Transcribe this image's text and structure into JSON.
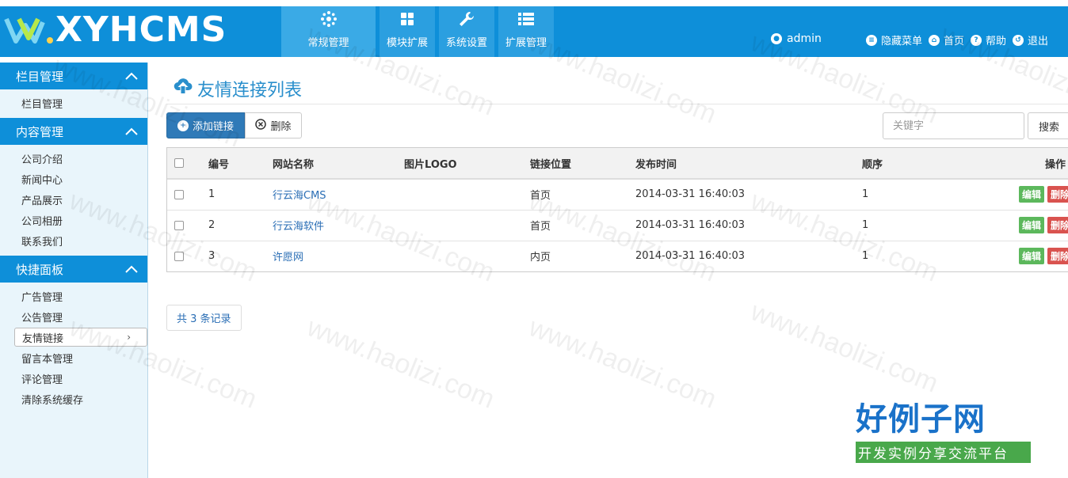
{
  "app": {
    "logo_text": "XYHCMS"
  },
  "topnav": [
    {
      "label": "常规管理",
      "icon": "gear-flower-icon",
      "active": true
    },
    {
      "label": "模块扩展",
      "icon": "grid-icon",
      "active": false
    },
    {
      "label": "系统设置",
      "icon": "wrench-icon",
      "active": false
    },
    {
      "label": "扩展管理",
      "icon": "list-icon",
      "active": false
    }
  ],
  "user": {
    "name": "admin"
  },
  "rightnav": [
    {
      "label": "隐藏菜单",
      "icon": "list-circle-icon"
    },
    {
      "label": "首页",
      "icon": "home-icon"
    },
    {
      "label": "帮助",
      "icon": "help-icon"
    },
    {
      "label": "退出",
      "icon": "logout-icon"
    }
  ],
  "sidebar": [
    {
      "title": "栏目管理",
      "items": [
        "栏目管理"
      ]
    },
    {
      "title": "内容管理",
      "items": [
        "公司介绍",
        "新闻中心",
        "产品展示",
        "公司相册",
        "联系我们"
      ]
    },
    {
      "title": "快捷面板",
      "items": [
        "广告管理",
        "公告管理",
        "友情链接",
        "留言本管理",
        "评论管理",
        "清除系统缓存"
      ],
      "active_index": 2
    }
  ],
  "page": {
    "title": "友情连接列表",
    "add_label": "添加链接",
    "delete_label": "删除",
    "search_placeholder": "关键字",
    "search_label": "搜索"
  },
  "table": {
    "headers": [
      "编号",
      "网站名称",
      "图片LOGO",
      "链接位置",
      "发布时间",
      "顺序",
      "操作"
    ],
    "rows": [
      {
        "id": "1",
        "name": "行云海CMS",
        "logo": "",
        "position": "首页",
        "time": "2014-03-31 16:40:03",
        "order": "1"
      },
      {
        "id": "2",
        "name": "行云海软件",
        "logo": "",
        "position": "首页",
        "time": "2014-03-31 16:40:03",
        "order": "1"
      },
      {
        "id": "3",
        "name": "许愿网",
        "logo": "",
        "position": "内页",
        "time": "2014-03-31 16:40:03",
        "order": "1"
      }
    ],
    "edit_label": "编辑",
    "remove_label": "删除"
  },
  "pager": {
    "text": "共 3 条记录"
  },
  "watermark": {
    "text": "www.haolizi.com",
    "brand": "好例子网",
    "brand_sub": "开发实例分享交流平台"
  },
  "colors": {
    "primary": "#0e8fd9",
    "edit": "#5cb85c",
    "remove": "#d9534f"
  }
}
